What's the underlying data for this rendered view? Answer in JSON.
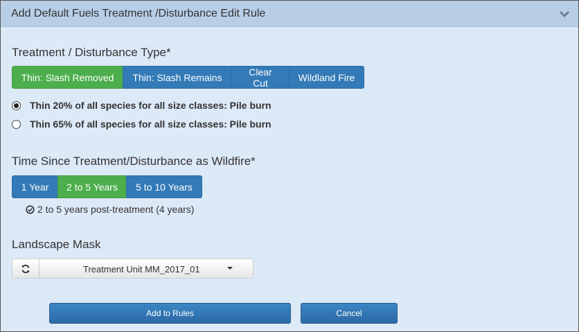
{
  "header": {
    "title": "Add Default Fuels Treatment /Disturbance Edit Rule"
  },
  "treatment": {
    "label": "Treatment / Disturbance Type*",
    "buttons": [
      {
        "label": "Thin: Slash Removed",
        "active": true
      },
      {
        "label": "Thin: Slash Remains",
        "active": false
      },
      {
        "label": "Clear Cut",
        "active": false
      },
      {
        "label": "Wildland Fire",
        "active": false
      }
    ],
    "options": [
      {
        "label": "Thin 20% of all species for all size classes: Pile burn",
        "checked": true
      },
      {
        "label": "Thin 65% of all species for all size classes: Pile burn",
        "checked": false
      }
    ]
  },
  "time": {
    "label": "Time Since Treatment/Disturbance as Wildfire*",
    "buttons": [
      {
        "label": "1 Year",
        "active": false
      },
      {
        "label": "2 to 5 Years",
        "active": true
      },
      {
        "label": "5 to 10 Years",
        "active": false
      }
    ],
    "status": "2 to 5 years post-treatment (4 years)"
  },
  "mask": {
    "label": "Landscape Mask",
    "selected": "Treatment Unit MM_2017_01"
  },
  "actions": {
    "add_label": "Add to Rules",
    "cancel_label": "Cancel"
  },
  "colors": {
    "primary": "#337ab7",
    "success": "#4cae4c",
    "background": "#dce9f7",
    "header": "#b8cee6"
  }
}
